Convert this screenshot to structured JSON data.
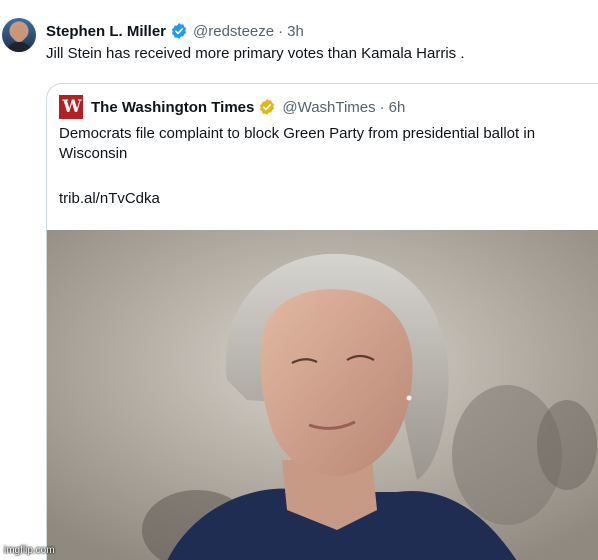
{
  "tweet": {
    "author_name": "Stephen L. Miller",
    "handle": "@redsteeze",
    "separator": "·",
    "time": "3h",
    "text": "Jill Stein has received more primary votes than Kamala Harris .",
    "verified_icon": "blue-verified-badge-icon"
  },
  "quote": {
    "logo_text": "W",
    "author_name": "The Washington Times",
    "handle": "@WashTimes",
    "separator": "·",
    "time": "6h",
    "text": "Democrats file complaint to block Green Party from presidential ballot in Wisconsin",
    "link": "trib.al/nTvCdka",
    "verified_icon": "gold-verified-badge-icon",
    "brand_color": "#b41f24"
  },
  "watermark": "imgflip.com",
  "colors": {
    "text": "#0f1419",
    "muted": "#536471",
    "verified_blue": "#1d9bf0",
    "verified_gold": "#e2b719",
    "border": "#cfd9de"
  }
}
